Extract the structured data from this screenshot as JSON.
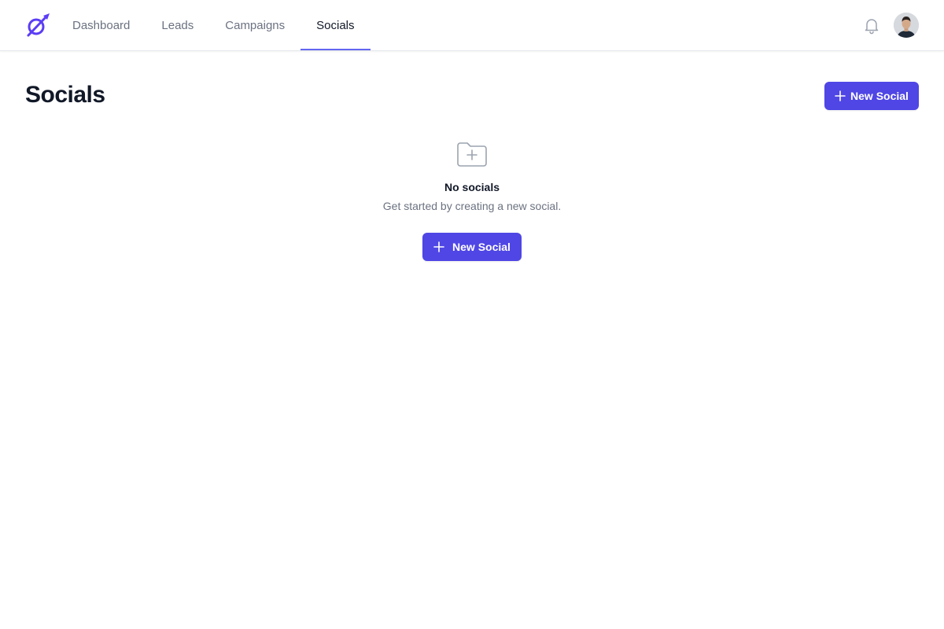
{
  "nav": {
    "items": [
      {
        "label": "Dashboard",
        "active": false
      },
      {
        "label": "Leads",
        "active": false
      },
      {
        "label": "Campaigns",
        "active": false
      },
      {
        "label": "Socials",
        "active": true
      }
    ]
  },
  "header": {
    "logo_icon": "rocket-orbit-icon",
    "notifications_icon": "bell-icon",
    "avatar_icon": "user-avatar"
  },
  "page": {
    "title": "Socials",
    "new_button_label": "New Social"
  },
  "empty_state": {
    "icon": "folder-plus-icon",
    "title": "No socials",
    "description": "Get started by creating a new social.",
    "button_label": "New Social"
  },
  "colors": {
    "accent": "#4f46e5",
    "active_tab_indicator": "#6366f1",
    "text_primary": "#111827",
    "text_secondary": "#6b7280"
  }
}
